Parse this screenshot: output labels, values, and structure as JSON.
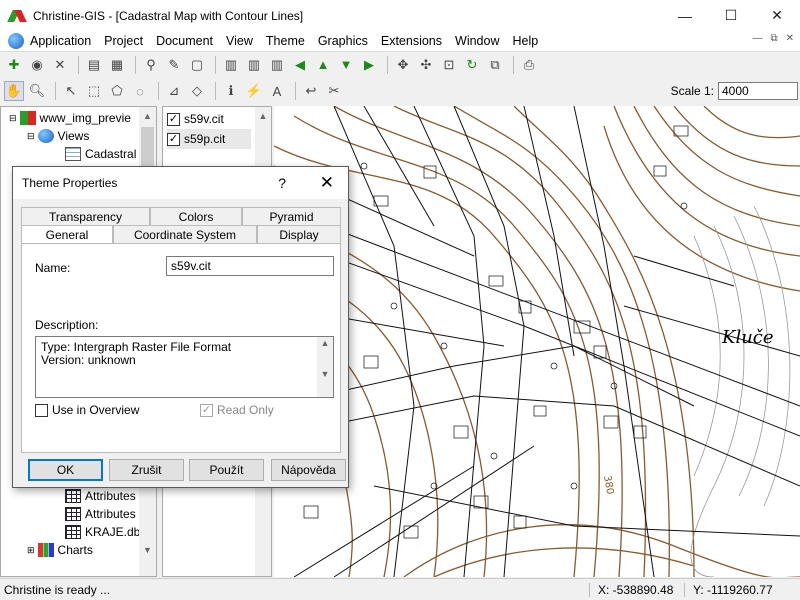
{
  "window": {
    "title": "Christine-GIS - [Cadastral Map with Contour Lines]",
    "minimize": "—",
    "maximize": "☐",
    "close": "✕"
  },
  "menu": {
    "items": [
      "Application",
      "Project",
      "Document",
      "View",
      "Theme",
      "Graphics",
      "Extensions",
      "Window",
      "Help"
    ],
    "mdi": [
      "—",
      "⧉",
      "✕"
    ]
  },
  "toolbar2": {
    "scale_label": "Scale 1:",
    "scale_value": "4000"
  },
  "tree": {
    "items": [
      {
        "label": "www_img_previe",
        "icon": "project-logo-icon"
      },
      {
        "label": "Views",
        "icon": "globe-icon"
      },
      {
        "label": "Cadastral",
        "icon": "view-icon"
      },
      {
        "label": "Attributes",
        "icon": "table-icon"
      },
      {
        "label": "Attributes",
        "icon": "table-icon"
      },
      {
        "label": "KRAJE.dbf",
        "icon": "table-icon"
      },
      {
        "label": "Charts",
        "icon": "chart-icon"
      }
    ]
  },
  "legend": {
    "items": [
      {
        "label": "s59v.cit",
        "checked": true
      },
      {
        "label": "s59p.cit",
        "checked": true
      }
    ]
  },
  "map": {
    "place_label": "Kluče",
    "contour_label": "380"
  },
  "dialog": {
    "title": "Theme Properties",
    "help": "?",
    "close": "✕",
    "tabs_back": [
      "Transparency",
      "Colors",
      "Pyramid"
    ],
    "tabs_front": [
      "General",
      "Coordinate System",
      "Display"
    ],
    "name_label": "Name:",
    "name_value": "s59v.cit",
    "description_label": "Description:",
    "description_line1": "Type: Intergraph Raster File Format",
    "description_line2": "Version: unknown",
    "use_in_overview": "Use in Overview",
    "use_in_overview_checked": false,
    "read_only": "Read Only",
    "read_only_checked": true,
    "buttons": {
      "ok": "OK",
      "cancel": "Zrušit",
      "apply": "Použít",
      "help": "Nápověda"
    }
  },
  "status": {
    "message": "Christine is ready ...",
    "x": "X: -538890.48",
    "y": "Y: -1119260.77"
  },
  "colors": {
    "contour": "#8b5a2b",
    "accent": "#0078d7"
  }
}
